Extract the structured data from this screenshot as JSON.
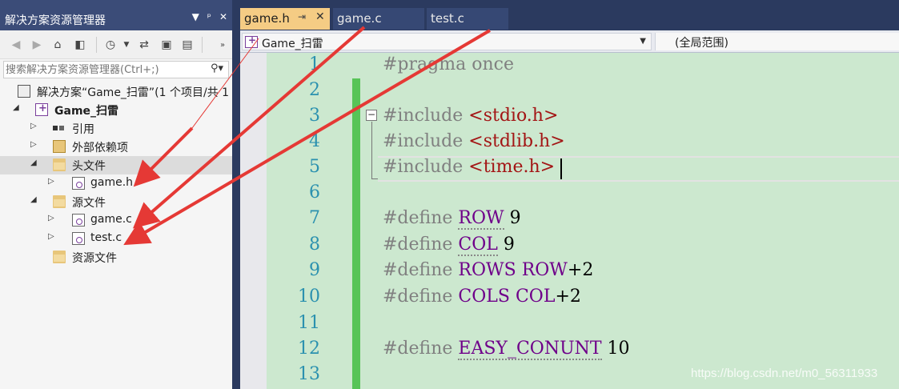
{
  "solution_explorer": {
    "title": "解决方案资源管理器",
    "title_buttons": [
      "▼",
      "ᵖ",
      "✕"
    ],
    "search_placeholder": "搜索解决方案资源管理器(Ctrl+;)",
    "tree": [
      {
        "label": "解决方案“Game_扫雷”(1 个项目/共 1",
        "icon": "solution-icon",
        "bold": false
      },
      {
        "label": "Game_扫雷",
        "icon": "project-icon",
        "bold": true
      },
      {
        "label": "引用",
        "icon": "references-icon"
      },
      {
        "label": "外部依赖项",
        "icon": "external-deps-icon"
      },
      {
        "label": "头文件",
        "icon": "folder-icon"
      },
      {
        "label": "game.h",
        "icon": "header-file-icon"
      },
      {
        "label": "源文件",
        "icon": "folder-icon"
      },
      {
        "label": "game.c",
        "icon": "c-file-icon"
      },
      {
        "label": "test.c",
        "icon": "c-file-icon"
      },
      {
        "label": "资源文件",
        "icon": "folder-icon"
      }
    ]
  },
  "tabs": [
    {
      "label": "game.h",
      "active": true,
      "pin": "⇥",
      "close": "✕"
    },
    {
      "label": "game.c",
      "active": false
    },
    {
      "label": "test.c",
      "active": false
    }
  ],
  "navbar": {
    "project": "Game_扫雷",
    "scope": "(全局范围)"
  },
  "code": {
    "line_numbers": [
      "1",
      "2",
      "3",
      "4",
      "5",
      "6",
      "7",
      "8",
      "9",
      "10",
      "11",
      "12",
      "13"
    ],
    "lines": [
      {
        "kw": "#pragma once"
      },
      {},
      {
        "kw": "#include ",
        "str": "<stdio.h>"
      },
      {
        "kw": "#include ",
        "str": "<stdlib.h>"
      },
      {
        "kw": "#include ",
        "str": "<time.h>"
      },
      {},
      {
        "kw": "#define ",
        "mac": "ROW",
        "rest": " 9"
      },
      {
        "kw": "#define ",
        "mac": "COL",
        "rest": " 9"
      },
      {
        "kw": "#define ",
        "mac": "ROWS",
        "mac2": "ROW",
        "rest": "+2"
      },
      {
        "kw": "#define ",
        "mac": "COLS",
        "mac2": "COL",
        "rest": "+2"
      },
      {},
      {
        "kw": "#define ",
        "mac": "EASY_CONUNT",
        "rest": " 10"
      },
      {}
    ]
  },
  "watermark": "https://blog.csdn.net/m0_56311933",
  "colors": {
    "accent_tab": "#f5cc84",
    "arrow": "#e53935",
    "editor_bg": "#cce8cf"
  }
}
